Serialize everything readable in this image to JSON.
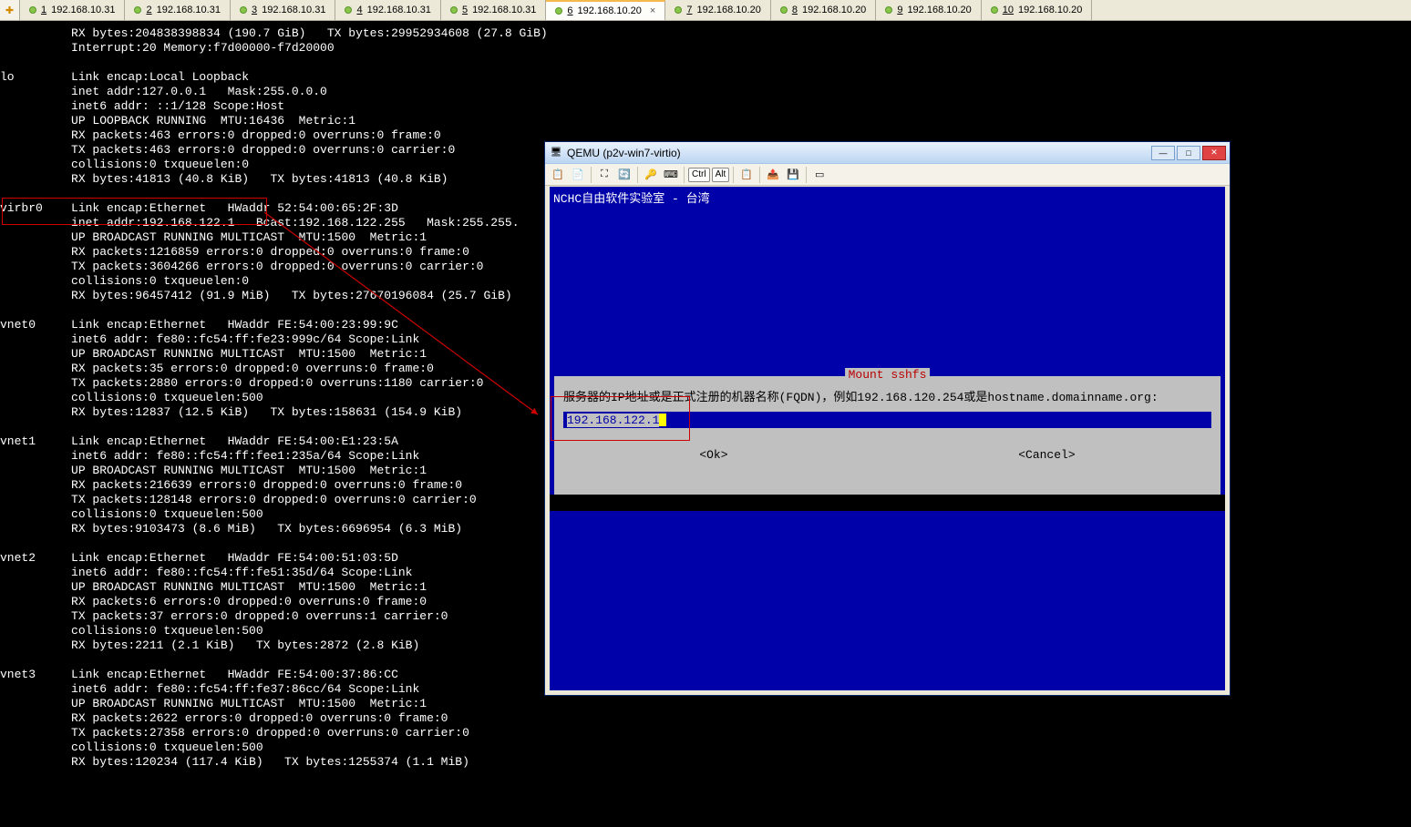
{
  "tabs": [
    {
      "num": "1",
      "ip": "192.168.10.31"
    },
    {
      "num": "2",
      "ip": "192.168.10.31"
    },
    {
      "num": "3",
      "ip": "192.168.10.31"
    },
    {
      "num": "4",
      "ip": "192.168.10.31"
    },
    {
      "num": "5",
      "ip": "192.168.10.31"
    },
    {
      "num": "6",
      "ip": "192.168.10.20"
    },
    {
      "num": "7",
      "ip": "192.168.10.20"
    },
    {
      "num": "8",
      "ip": "192.168.10.20"
    },
    {
      "num": "9",
      "ip": "192.168.10.20"
    },
    {
      "num": "10",
      "ip": "192.168.10.20"
    }
  ],
  "active_tab_index": 5,
  "terminal_lines": [
    "          RX bytes:204838398834 (190.7 GiB)   TX bytes:29952934608 (27.8 GiB)",
    "          Interrupt:20 Memory:f7d00000-f7d20000",
    "",
    "lo        Link encap:Local Loopback",
    "          inet addr:127.0.0.1   Mask:255.0.0.0",
    "          inet6 addr: ::1/128 Scope:Host",
    "          UP LOOPBACK RUNNING  MTU:16436  Metric:1",
    "          RX packets:463 errors:0 dropped:0 overruns:0 frame:0",
    "          TX packets:463 errors:0 dropped:0 overruns:0 carrier:0",
    "          collisions:0 txqueuelen:0",
    "          RX bytes:41813 (40.8 KiB)   TX bytes:41813 (40.8 KiB)",
    "",
    "virbr0    Link encap:Ethernet   HWaddr 52:54:00:65:2F:3D",
    "          inet addr:192.168.122.1   Bcast:192.168.122.255   Mask:255.255.",
    "          UP BROADCAST RUNNING MULTICAST  MTU:1500  Metric:1",
    "          RX packets:1216859 errors:0 dropped:0 overruns:0 frame:0",
    "          TX packets:3604266 errors:0 dropped:0 overruns:0 carrier:0",
    "          collisions:0 txqueuelen:0",
    "          RX bytes:96457412 (91.9 MiB)   TX bytes:27670196084 (25.7 GiB)",
    "",
    "vnet0     Link encap:Ethernet   HWaddr FE:54:00:23:99:9C",
    "          inet6 addr: fe80::fc54:ff:fe23:999c/64 Scope:Link",
    "          UP BROADCAST RUNNING MULTICAST  MTU:1500  Metric:1",
    "          RX packets:35 errors:0 dropped:0 overruns:0 frame:0",
    "          TX packets:2880 errors:0 dropped:0 overruns:1180 carrier:0",
    "          collisions:0 txqueuelen:500",
    "          RX bytes:12837 (12.5 KiB)   TX bytes:158631 (154.9 KiB)",
    "",
    "vnet1     Link encap:Ethernet   HWaddr FE:54:00:E1:23:5A",
    "          inet6 addr: fe80::fc54:ff:fee1:235a/64 Scope:Link",
    "          UP BROADCAST RUNNING MULTICAST  MTU:1500  Metric:1",
    "          RX packets:216639 errors:0 dropped:0 overruns:0 frame:0",
    "          TX packets:128148 errors:0 dropped:0 overruns:0 carrier:0",
    "          collisions:0 txqueuelen:500",
    "          RX bytes:9103473 (8.6 MiB)   TX bytes:6696954 (6.3 MiB)",
    "",
    "vnet2     Link encap:Ethernet   HWaddr FE:54:00:51:03:5D",
    "          inet6 addr: fe80::fc54:ff:fe51:35d/64 Scope:Link",
    "          UP BROADCAST RUNNING MULTICAST  MTU:1500  Metric:1",
    "          RX packets:6 errors:0 dropped:0 overruns:0 frame:0",
    "          TX packets:37 errors:0 dropped:0 overruns:1 carrier:0",
    "          collisions:0 txqueuelen:500",
    "          RX bytes:2211 (2.1 KiB)   TX bytes:2872 (2.8 KiB)",
    "",
    "vnet3     Link encap:Ethernet   HWaddr FE:54:00:37:86:CC",
    "          inet6 addr: fe80::fc54:ff:fe37:86cc/64 Scope:Link",
    "          UP BROADCAST RUNNING MULTICAST  MTU:1500  Metric:1",
    "          RX packets:2622 errors:0 dropped:0 overruns:0 frame:0",
    "          TX packets:27358 errors:0 dropped:0 overruns:0 carrier:0",
    "          collisions:0 txqueuelen:500",
    "          RX bytes:120234 (117.4 KiB)   TX bytes:1255374 (1.1 MiB)"
  ],
  "qemu": {
    "title": "QEMU (p2v-win7-virtio)",
    "screen_header": "NCHC自由软件实验室 - 台湾",
    "dialog": {
      "title": "Mount sshfs",
      "prompt": "服务器的IP地址或是正式注册的机器名称(FQDN)，例如192.168.120.254或是hostname.domainname.org:",
      "input_value": "192.168.122.1",
      "ok": "<Ok>",
      "cancel": "<Cancel>"
    },
    "toolbar": {
      "ctrl": "Ctrl",
      "alt": "Alt"
    }
  }
}
